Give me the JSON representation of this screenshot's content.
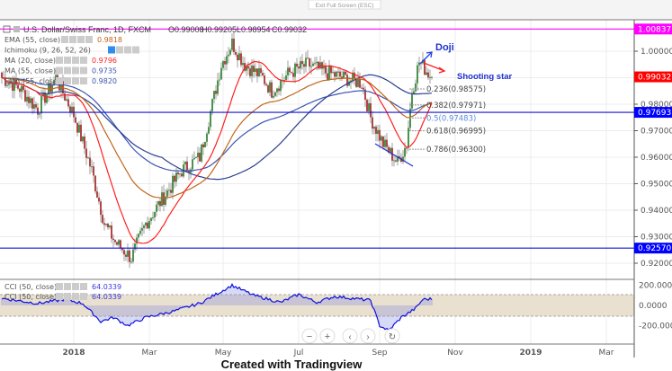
{
  "exit_fullscreen": "Exit Full Screen (ESC)",
  "header": {
    "symbol": "U.S. Dollar/Swiss Franc, 1D, FXCM",
    "open": "O0.99008",
    "high": "H0.99205",
    "low": "L0.98954",
    "close": "C0.99032"
  },
  "legend": [
    {
      "label": "EMA (55, close)",
      "value": "0.9818",
      "color": "#c0661c"
    },
    {
      "label": "Ichimoku (9, 26, 52, 26)",
      "value": "",
      "color": "#888888"
    },
    {
      "label": "MA (20, close)",
      "value": "0.9796",
      "color": "#ff2020"
    },
    {
      "label": "MA (55, close)",
      "value": "0.9735",
      "color": "#3a56b0"
    },
    {
      "label": "EMA (55, close)",
      "value": "0.9820",
      "color": "#3a56b0"
    }
  ],
  "cci_legend": [
    {
      "label": "CCI (50, close)",
      "value": "64.0339"
    },
    {
      "label": "CCI (50, close)",
      "value": "64.0339"
    }
  ],
  "annotations": {
    "doji": "Doji",
    "shooting_star": "Shooting star"
  },
  "fib_levels": [
    {
      "label": "0.236(0.98575)",
      "price": 0.98575
    },
    {
      "label": "0.382(0.97971)",
      "price": 0.97971
    },
    {
      "label": "0.5(0.97483)",
      "price": 0.97483
    },
    {
      "label": "0.618(0.96995)",
      "price": 0.96995
    },
    {
      "label": "0.786(0.96300)",
      "price": 0.963
    }
  ],
  "price_tags": [
    {
      "label": "1.00837",
      "price": 1.00837,
      "color": "#ff00ff"
    },
    {
      "label": "0.99032",
      "price": 0.99032,
      "color": "#ff0000"
    },
    {
      "label": "0.97693",
      "price": 0.97693,
      "color": "#0000ff"
    },
    {
      "label": "0.92570",
      "price": 0.9257,
      "color": "#0000ff"
    }
  ],
  "footer": "Created with Tradingview",
  "chart_data": {
    "type": "candlestick",
    "title": "U.S. Dollar/Swiss Franc, 1D, FXCM",
    "y_ticks": [
      "1.00000",
      "0.99000",
      "0.98000",
      "0.97000",
      "0.96000",
      "0.95000",
      "0.94000",
      "0.93000",
      "0.92000"
    ],
    "y_tick_values": [
      1.0,
      0.99,
      0.98,
      0.97,
      0.96,
      0.95,
      0.94,
      0.93,
      0.92
    ],
    "ylim": [
      0.915,
      1.013
    ],
    "x_ticks": [
      "2018",
      "Mar",
      "May",
      "Jul",
      "Sep",
      "Nov",
      "2019",
      "Mar"
    ],
    "x_tick_bars": [
      40,
      82,
      123,
      165,
      210,
      252,
      294,
      336
    ],
    "close_anchors": [
      [
        0,
        0.99
      ],
      [
        10,
        0.986
      ],
      [
        20,
        0.978
      ],
      [
        30,
        0.99
      ],
      [
        40,
        0.976
      ],
      [
        50,
        0.955
      ],
      [
        57,
        0.935
      ],
      [
        63,
        0.928
      ],
      [
        72,
        0.922
      ],
      [
        80,
        0.935
      ],
      [
        90,
        0.945
      ],
      [
        100,
        0.955
      ],
      [
        110,
        0.96
      ],
      [
        117,
        0.98
      ],
      [
        122,
        0.995
      ],
      [
        128,
        1.003
      ],
      [
        135,
        0.995
      ],
      [
        145,
        0.99
      ],
      [
        150,
        0.985
      ],
      [
        160,
        0.992
      ],
      [
        170,
        0.995
      ],
      [
        180,
        0.992
      ],
      [
        190,
        0.99
      ],
      [
        200,
        0.988
      ],
      [
        205,
        0.975
      ],
      [
        212,
        0.965
      ],
      [
        220,
        0.958
      ],
      [
        225,
        0.965
      ],
      [
        228,
        0.985
      ],
      [
        232,
        0.996
      ],
      [
        239,
        0.99
      ]
    ],
    "cci_ticks": [
      "200.0000",
      "0.0000",
      "-200.0000"
    ],
    "cci_anchors": [
      [
        0,
        70
      ],
      [
        20,
        20
      ],
      [
        35,
        60
      ],
      [
        45,
        20
      ],
      [
        55,
        -160
      ],
      [
        62,
        -120
      ],
      [
        70,
        -200
      ],
      [
        80,
        -120
      ],
      [
        95,
        -60
      ],
      [
        110,
        20
      ],
      [
        120,
        120
      ],
      [
        128,
        200
      ],
      [
        140,
        100
      ],
      [
        155,
        30
      ],
      [
        165,
        110
      ],
      [
        175,
        30
      ],
      [
        185,
        90
      ],
      [
        205,
        50
      ],
      [
        210,
        -200
      ],
      [
        215,
        -250
      ],
      [
        222,
        -120
      ],
      [
        230,
        -30
      ],
      [
        234,
        60
      ],
      [
        239,
        64
      ]
    ]
  }
}
